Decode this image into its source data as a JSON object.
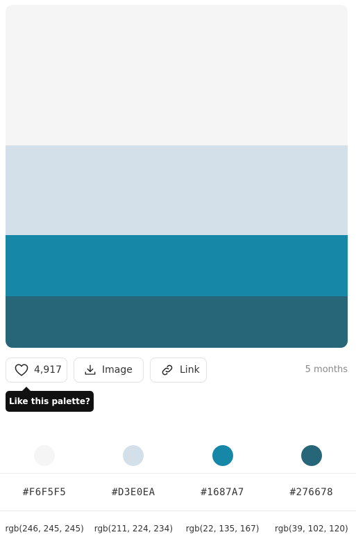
{
  "palette": {
    "colors": [
      {
        "hex": "#F6F5F5",
        "hex_label": "#F6F5F5",
        "rgb_label": "rgb(246, 245, 245)"
      },
      {
        "hex": "#D3E0EA",
        "hex_label": "#D3E0EA",
        "rgb_label": "rgb(211, 224, 234)"
      },
      {
        "hex": "#1687A7",
        "hex_label": "#1687A7",
        "rgb_label": "rgb(22, 135, 167)"
      },
      {
        "hex": "#276678",
        "hex_label": "#276678",
        "rgb_label": "rgb(39, 102, 120)"
      }
    ]
  },
  "actions": {
    "like_count": "4,917",
    "image_label": "Image",
    "link_label": "Link",
    "age": "5 months"
  },
  "tooltip": {
    "text": "Like this palette?"
  },
  "icons": {
    "like": "heart-icon",
    "image": "download-icon",
    "link": "link-icon"
  }
}
